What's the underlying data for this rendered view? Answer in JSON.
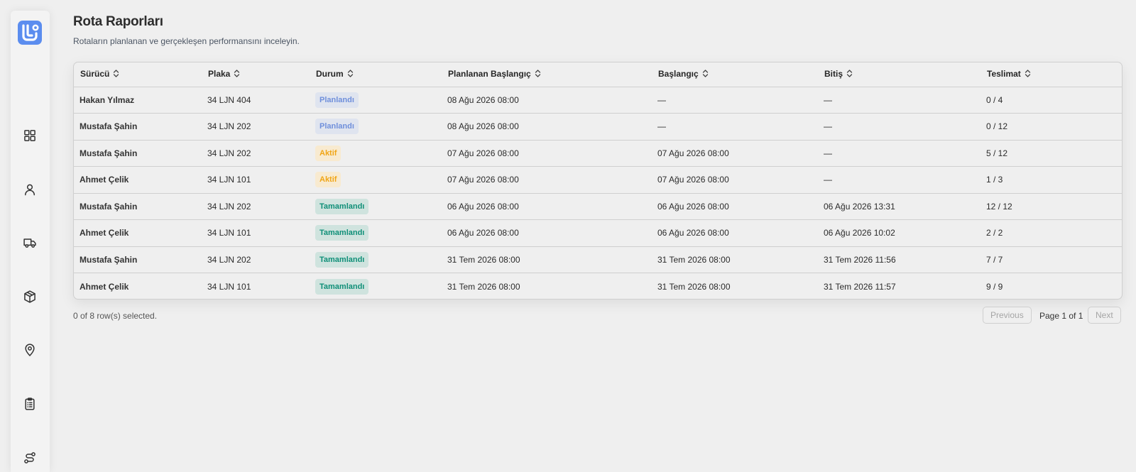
{
  "page": {
    "title": "Rota Raporları",
    "subtitle": "Rotaların planlanan ve gerçekleşen performansını inceleyin."
  },
  "sidebar": {
    "logo_icon": "logo-icon",
    "items": [
      {
        "icon": "dashboard-grid-icon"
      },
      {
        "icon": "user-icon"
      },
      {
        "icon": "truck-icon"
      },
      {
        "icon": "package-icon"
      },
      {
        "icon": "map-pin-icon"
      },
      {
        "icon": "clipboard-list-icon"
      },
      {
        "icon": "route-icon"
      }
    ]
  },
  "table": {
    "headers": [
      "Sürücü",
      "Plaka",
      "Durum",
      "Planlanan Başlangıç",
      "Başlangıç",
      "Bitiş",
      "Teslimat"
    ],
    "rows": [
      {
        "driver": "Hakan Yılmaz",
        "plate": "34 LJN 404",
        "status": "Planlandı",
        "status_type": "planned",
        "planned_start": "08 Ağu 2026 08:00",
        "start": "—",
        "end": "—",
        "delivery": "0 / 4"
      },
      {
        "driver": "Mustafa Şahin",
        "plate": "34 LJN 202",
        "status": "Planlandı",
        "status_type": "planned",
        "planned_start": "08 Ağu 2026 08:00",
        "start": "—",
        "end": "—",
        "delivery": "0 / 12"
      },
      {
        "driver": "Mustafa Şahin",
        "plate": "34 LJN 202",
        "status": "Aktif",
        "status_type": "active",
        "planned_start": "07 Ağu 2026 08:00",
        "start": "07 Ağu 2026 08:00",
        "end": "—",
        "delivery": "5 / 12"
      },
      {
        "driver": "Ahmet Çelik",
        "plate": "34 LJN 101",
        "status": "Aktif",
        "status_type": "active",
        "planned_start": "07 Ağu 2026 08:00",
        "start": "07 Ağu 2026 08:00",
        "end": "—",
        "delivery": "1 / 3"
      },
      {
        "driver": "Mustafa Şahin",
        "plate": "34 LJN 202",
        "status": "Tamamlandı",
        "status_type": "done",
        "planned_start": "06 Ağu 2026 08:00",
        "start": "06 Ağu 2026 08:00",
        "end": "06 Ağu 2026 13:31",
        "delivery": "12 / 12"
      },
      {
        "driver": "Ahmet Çelik",
        "plate": "34 LJN 101",
        "status": "Tamamlandı",
        "status_type": "done",
        "planned_start": "06 Ağu 2026 08:00",
        "start": "06 Ağu 2026 08:00",
        "end": "06 Ağu 2026 10:02",
        "delivery": "2 / 2"
      },
      {
        "driver": "Mustafa Şahin",
        "plate": "34 LJN 202",
        "status": "Tamamlandı",
        "status_type": "done",
        "planned_start": "31 Tem 2026 08:00",
        "start": "31 Tem 2026 08:00",
        "end": "31 Tem 2026 11:56",
        "delivery": "7 / 7"
      },
      {
        "driver": "Ahmet Çelik",
        "plate": "34 LJN 101",
        "status": "Tamamlandı",
        "status_type": "done",
        "planned_start": "31 Tem 2026 08:00",
        "start": "31 Tem 2026 08:00",
        "end": "31 Tem 2026 11:57",
        "delivery": "9 / 9"
      }
    ]
  },
  "footer": {
    "selection_info": "0 of 8 row(s) selected.",
    "previous_label": "Previous",
    "page_info": "Page 1 of 1",
    "next_label": "Next"
  },
  "colors": {
    "planned_bg": "#dfe4ef",
    "planned_text": "#6f8fdb",
    "active_bg": "#f8ead0",
    "active_text": "#f0a516",
    "done_bg": "#cfe3de",
    "done_text": "#0f8f78",
    "logo": "#5b8def"
  }
}
